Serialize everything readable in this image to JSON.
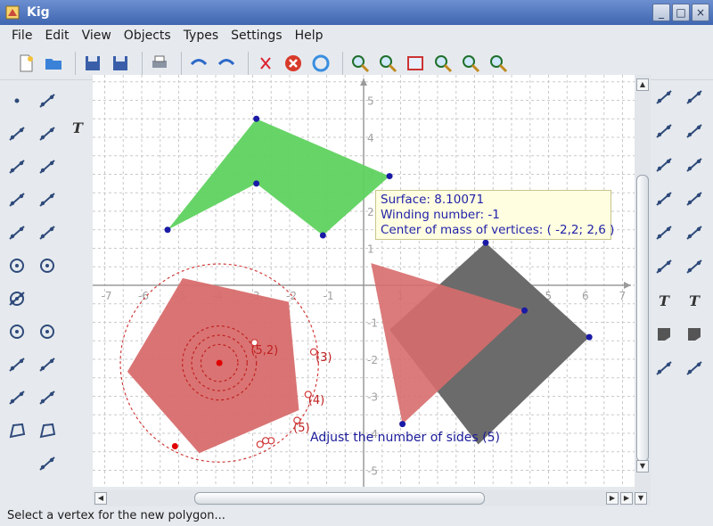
{
  "app": {
    "title": "Kig"
  },
  "window_buttons": [
    "_",
    "□",
    "×"
  ],
  "menu": [
    {
      "label": "File"
    },
    {
      "label": "Edit"
    },
    {
      "label": "View"
    },
    {
      "label": "Objects"
    },
    {
      "label": "Types"
    },
    {
      "label": "Settings"
    },
    {
      "label": "Help"
    }
  ],
  "toolbar": [
    {
      "icon": "new-document-icon"
    },
    {
      "icon": "open-folder-icon"
    },
    {
      "sep": true
    },
    {
      "icon": "save-icon"
    },
    {
      "icon": "save-as-icon"
    },
    {
      "sep": true
    },
    {
      "icon": "print-icon"
    },
    {
      "sep": true
    },
    {
      "icon": "undo-icon"
    },
    {
      "icon": "redo-icon"
    },
    {
      "sep": true
    },
    {
      "icon": "delete-icon"
    },
    {
      "icon": "cancel-construction-icon"
    },
    {
      "icon": "repeat-icon"
    },
    {
      "sep": true
    },
    {
      "icon": "zoom-in-icon"
    },
    {
      "icon": "zoom-out-icon"
    },
    {
      "icon": "fit-to-screen-icon"
    },
    {
      "icon": "select-zoom-icon"
    },
    {
      "icon": "zoom-rect-icon"
    },
    {
      "icon": "zoom-area-icon"
    }
  ],
  "left_tools": [
    "point-icon",
    "point-by-coordinates-icon",
    "intersection-point-icon",
    "midpoint-icon",
    "line-icon",
    "segment-icon",
    "ray-icon",
    "parallel-line-icon",
    "perpendicular-line-icon",
    "vector-icon",
    "circle-by-center-icon",
    "circle-by-three-points-icon",
    "circle-center-radius-icon",
    "arc-icon",
    "conic-icon",
    "ellipse-icon",
    "hyperbola-icon",
    "parabola-icon",
    "cubic-icon",
    "locus-icon",
    "polygon-vertices-icon",
    "polygon-sides-icon",
    "transform-icon",
    "text-label-icon"
  ],
  "right_tools": [
    "angle-icon",
    "bisector-icon",
    "measure-distance-icon",
    "measure-angle-icon",
    "reflect-icon",
    "rotate-icon",
    "text-label-icon",
    "area-icon",
    "script-icon"
  ],
  "tooltip": {
    "surface": "Surface: 8.10071",
    "winding": "Winding number: -1",
    "center": "Center of mass of vertices: ( -2,2; 2,6 )"
  },
  "canvas": {
    "x_ticks": [
      "-7",
      "-6",
      "-5",
      "-4",
      "-3",
      "-2",
      "-1",
      "1",
      "2",
      "3",
      "4",
      "5",
      "6",
      "7"
    ],
    "y_ticks": [
      "5",
      "4",
      "3",
      "2",
      "1",
      "-1",
      "-2",
      "-3",
      "-4",
      "-5"
    ],
    "polygon_labels": [
      "(3)",
      "(4)",
      "(5)",
      "(5,2)"
    ],
    "adjust_text": "Adjust the number of sides (5)",
    "colors": {
      "green": "#5fd25f",
      "red": "#d86d6d",
      "gray": "#6b6b6b",
      "vertex": "#1a1aa6"
    }
  },
  "status": {
    "text": "Select a vertex for the new polygon..."
  }
}
